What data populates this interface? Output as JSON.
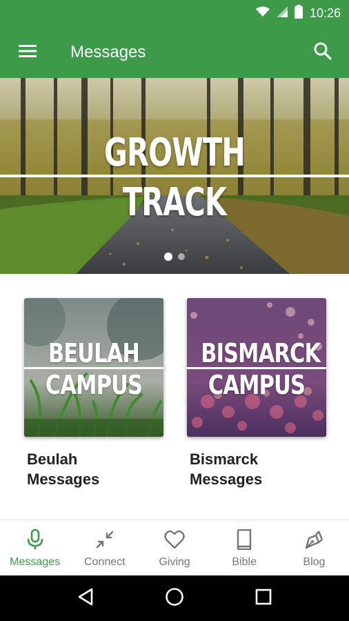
{
  "status_bar": {
    "time": "10:26",
    "icons": [
      "wifi-icon",
      "signal-icon",
      "battery-icon"
    ]
  },
  "app_bar": {
    "title": "Messages",
    "menu_icon": "hamburger-menu-icon",
    "search_icon": "search-icon"
  },
  "hero": {
    "line1": "GROWTH",
    "line2": "TRACK",
    "slides_total": 2,
    "active_slide": 1
  },
  "campuses": [
    {
      "thumb_line1": "BEULAH",
      "thumb_line2": "CAMPUS",
      "caption_line1": "Beulah",
      "caption_line2": "Messages"
    },
    {
      "thumb_line1": "BISMARCK",
      "thumb_line2": "CAMPUS",
      "caption_line1": "Bismarck",
      "caption_line2": "Messages"
    }
  ],
  "bottom_nav": {
    "items": [
      {
        "label": "Messages",
        "icon": "microphone-icon",
        "active": true
      },
      {
        "label": "Connect",
        "icon": "connect-arrows-icon",
        "active": false
      },
      {
        "label": "Giving",
        "icon": "heart-icon",
        "active": false
      },
      {
        "label": "Bible",
        "icon": "book-icon",
        "active": false
      },
      {
        "label": "Blog",
        "icon": "pen-nib-icon",
        "active": false
      }
    ]
  },
  "system_nav": {
    "icons": [
      "back-triangle-icon",
      "home-circle-icon",
      "recents-square-icon"
    ]
  },
  "colors": {
    "primary": "#3d9a48",
    "inactive": "#757575",
    "text": "#212121"
  }
}
